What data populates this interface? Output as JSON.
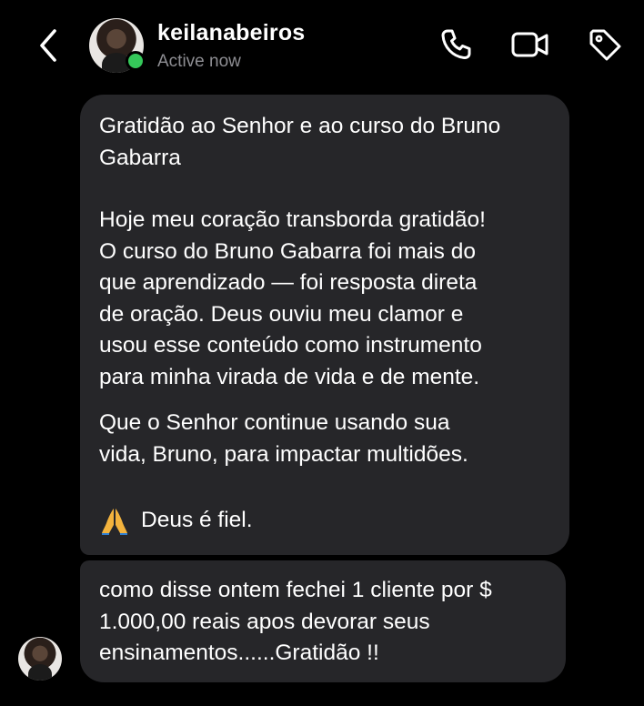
{
  "header": {
    "username": "keilanabeiros",
    "status": "Active now",
    "back_icon": "chevron-left-icon",
    "call_icon": "phone-icon",
    "video_icon": "video-camera-icon",
    "tag_icon": "tag-icon",
    "online_color": "#35c85a"
  },
  "messages": [
    {
      "paragraphs": [
        "Gratidão ao Senhor e ao curso do Bruno\nGabarra",
        "Hoje meu coração transborda gratidão!\nO curso do Bruno Gabarra foi mais do\nque aprendizado — foi resposta direta\nde oração. Deus ouviu meu clamor e\nusou esse conteúdo como instrumento\npara minha virada de vida e de mente.",
        "Que o Senhor continue usando sua\nvida, Bruno, para impactar multidões.",
        "Deus é fiel."
      ],
      "sign_icon": "praying-hands-icon"
    },
    {
      "text": "como disse ontem fechei 1 cliente por $\n1.000,00 reais apos devorar seus\nensinamentos......Gratidão !!"
    }
  ],
  "colors": {
    "background": "#000000",
    "bubble": "#262629",
    "muted_text": "#8e8e93"
  }
}
